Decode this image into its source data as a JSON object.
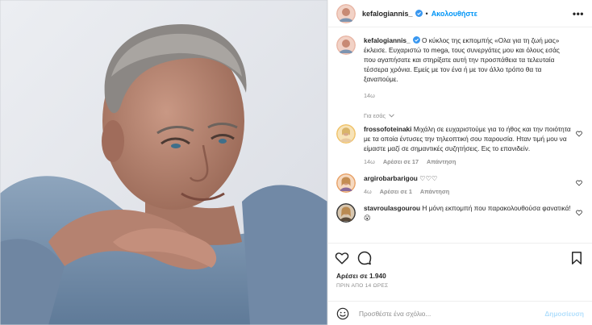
{
  "header": {
    "username": "kefalogiannis_",
    "separator": "•",
    "follow_label": "Ακολουθήστε",
    "more_icon": "more-horizontal-icon",
    "more_label": "•••"
  },
  "caption": {
    "username": "kefalogiannis_",
    "text": "Ο κύκλος της εκπομπής «Ολα για τη ζωή μας» έκλεισε. Ευχαριστώ το mega, τους συνεργάτες μου και όλους εσάς που αγαπήσατε και στηρίξατε αυτή την προσπάθεια τα τελευταία τέσσερα χρόνια. Εμείς με τον ένα ή με τον άλλο τρόπο θα τα ξαναπούμε.",
    "age": "14ω"
  },
  "translate_label": "Για εσάς",
  "comments": [
    {
      "username": "frossofoteinaki",
      "text": "Μιχάλη σε ευχαριστούμε για το ήθος και την ποιότητα με τα οποία έντυσες την τηλεοπτική σου παρουσία. Ηταν τιμή μου να είμαστε μαζί σε σημαντικές συζητήσεις. Εις το επανιδείν.",
      "age": "14ω",
      "likes": "Αρέσει σε 17",
      "reply": "Απάντηση"
    },
    {
      "username": "argirobarbarigou",
      "text": "♡♡♡",
      "age": "4ω",
      "likes": "Αρέσει σε 1",
      "reply": "Απάντηση"
    },
    {
      "username": "stavroulasgourou",
      "text": "Η μόνη εκπομπή που παρακολουθούσα φανατικά!😮"
    }
  ],
  "likes_count": "Αρέσει σε 1.940",
  "post_time": "ΠΡΙΝ ΑΠΟ 14 ΩΡΕΣ",
  "add_comment": {
    "placeholder": "Προσθέστε ένα σχόλιο...",
    "post_label": "Δημοσίευση"
  },
  "colors": {
    "accent": "#0095f6",
    "verified": "#3897f0",
    "muted": "#8e8e8e"
  }
}
